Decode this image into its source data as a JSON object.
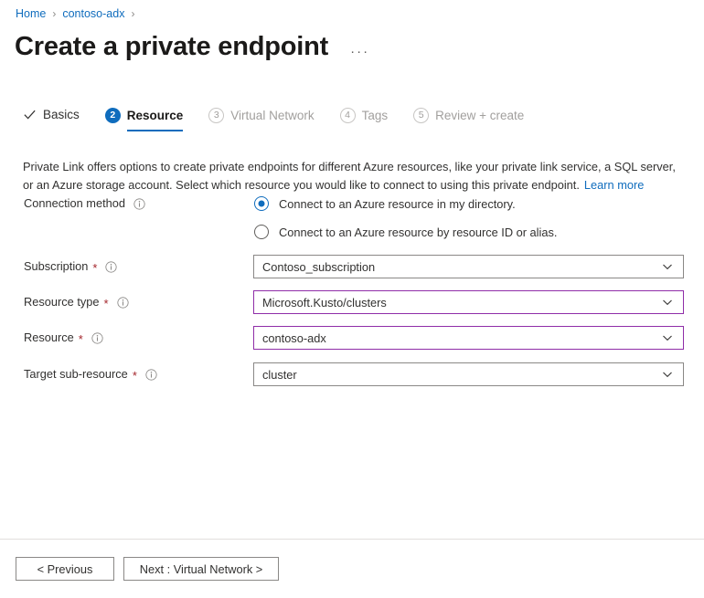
{
  "breadcrumb": {
    "items": [
      {
        "label": "Home"
      },
      {
        "label": "contoso-adx"
      }
    ],
    "separator": "›"
  },
  "header": {
    "title": "Create a private endpoint",
    "ellipsis": "···"
  },
  "tabs": [
    {
      "label": "Basics",
      "state": "done",
      "badge": "✓"
    },
    {
      "label": "Resource",
      "state": "active",
      "badge": "2"
    },
    {
      "label": "Virtual Network",
      "state": "disabled",
      "badge": "3"
    },
    {
      "label": "Tags",
      "state": "disabled",
      "badge": "4"
    },
    {
      "label": "Review + create",
      "state": "disabled",
      "badge": "5"
    }
  ],
  "description": {
    "text": "Private Link offers options to create private endpoints for different Azure resources, like your private link service, a SQL server, or an Azure storage account. Select which resource you would like to connect to using this private endpoint.",
    "learn_more": "Learn more"
  },
  "form": {
    "connection_method": {
      "label": "Connection method",
      "required": false,
      "options": [
        {
          "label": "Connect to an Azure resource in my directory.",
          "selected": true
        },
        {
          "label": "Connect to an Azure resource by resource ID or alias.",
          "selected": false
        }
      ]
    },
    "fields": [
      {
        "label": "Subscription",
        "required": true,
        "value": "Contoso_subscription",
        "accent": false
      },
      {
        "label": "Resource type",
        "required": true,
        "value": "Microsoft.Kusto/clusters",
        "accent": true
      },
      {
        "label": "Resource",
        "required": true,
        "value": "contoso-adx",
        "accent": true
      },
      {
        "label": "Target sub-resource",
        "required": true,
        "value": "cluster",
        "accent": false
      }
    ],
    "required_marker": "*"
  },
  "footer": {
    "previous_label": "< Previous",
    "next_label": "Next : Virtual Network >"
  },
  "colors": {
    "accent_blue": "#0f6cbd",
    "link_blue": "#0f6cbd",
    "required_red": "#a4262c",
    "field_accent_purple": "#8f2da8",
    "border_gray": "#8a8886",
    "disabled_gray": "#a19f9d",
    "divider": "#e1dfdd"
  }
}
